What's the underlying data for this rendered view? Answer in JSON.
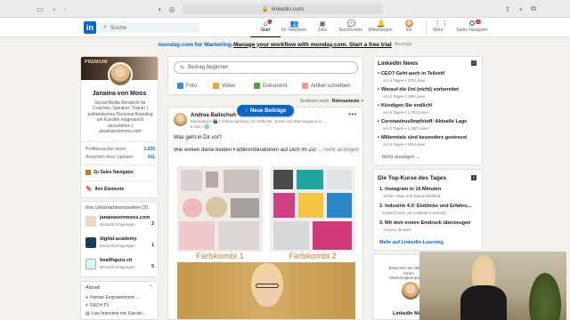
{
  "browser": {
    "url": "linkedin.com"
  },
  "nav": {
    "search_placeholder": "Suche",
    "items": [
      {
        "label": "Start",
        "badge": ""
      },
      {
        "label": "Ihr Netzwerk",
        "badge": ""
      },
      {
        "label": "Jobs",
        "badge": ""
      },
      {
        "label": "Nachrichten",
        "badge": ""
      },
      {
        "label": "Mitteilungen",
        "badge": ""
      },
      {
        "label": "Ich",
        "badge": ""
      },
      {
        "label": "Mehr",
        "badge": ""
      },
      {
        "label": "Sales Navigator",
        "badge": "99"
      }
    ],
    "start_badge": "1"
  },
  "ad_banner": {
    "brand": "monday.com for Marketing",
    "sep": " - ",
    "message": "Manage your workflow with monday.com. Start a free trial",
    "tag": "Anzeige"
  },
  "profile": {
    "premium": "PREMIUM",
    "name": "Janaina von Moos",
    "headline": "Social Media Beraterin für Coaches, Speaker, Trainer | authentisches Personal Branding um Kunden magnetisch anzuziehen | janainavonmoos.com",
    "stats": [
      {
        "label": "Profilbesucher:innen",
        "value": "1.025"
      },
      {
        "label": "Ansichten Ihrer Updates",
        "value": "411"
      }
    ],
    "sales_nav": "Zu Sales Navigator",
    "my_items": "Ihre Elemente"
  },
  "company_pages": {
    "title": "Ihre Unternehmensseiten (3)",
    "items": [
      {
        "name": "janainavonmoos.com",
        "sub": "Benachrichtigungen",
        "count": "2"
      },
      {
        "name": "digital-academy",
        "sub": "Benachrichtigungen",
        "count": "1"
      },
      {
        "name": "healthguru.ch",
        "sub": "Benachrichtigungen",
        "count": "5"
      }
    ]
  },
  "recent": {
    "title": "Aktuell",
    "items": [
      "Human Empowerment ...",
      "DACH TV",
      "Live Interview mit: Karolin..."
    ]
  },
  "composer": {
    "placeholder": "Beitrag beginnen",
    "actions": [
      "Foto",
      "Video",
      "Dokument",
      "Artikel schreiben"
    ]
  },
  "sort": {
    "label": "Sortieren nach:",
    "value": "Relevanteste"
  },
  "new_posts_button": "Neue Beiträge",
  "post": {
    "author": "Andrea Ballschuh",
    "degree": "• 1.",
    "sub": "Moderatorin 🎬 | Videocoaching | Ich helfe Dir, sicher und überzeugend in...",
    "time": "8 Std. • 🌐",
    "text1": "Was geht in Dir vor?",
    "text2": "Wie wirken diese beiden Farbkombinationen auf Dich im Zusammenhang",
    "more": "... mehr anzeigen",
    "label1": "Farbkombi 1",
    "label2": "Farbkombi 2"
  },
  "news": {
    "title": "LinkedIn News",
    "items": [
      {
        "title": "CEO? Geht auch in Teilzeit!",
        "meta": "vor 5 Tagen • 378 Leser"
      },
      {
        "title": "Worauf die Uni (nicht) vorbereitet",
        "meta": "vor 5 Tagen • 436 Leser"
      },
      {
        "title": "Kündigen Sie endlich!",
        "meta": "vor 9 Tagen • 1.702 Leser"
      },
      {
        "title": "Coronavirus/Impfstoff: Aktuelle Lage",
        "meta": "vor 2 Tagen • 1.000 Leser"
      },
      {
        "title": "Millennials sind besonders gestresst",
        "meta": "vor 6 Tagen • 355 Leser"
      }
    ],
    "more": "Mehr anzeigen"
  },
  "courses": {
    "title": "Die Top-Kurse des Tages",
    "items": [
      {
        "title": "1. Instagram in 10 Minuten",
        "author": "Achim Hepp und David Mühlfeld"
      },
      {
        "title": "2. Industrie 4.0: Einblicke und Erfahru...",
        "author": "Expert:innen von LinkedIn Learning"
      },
      {
        "title": "3. Mit dem ersten Eindruck überzeugen",
        "author": "Yvonne de Bark"
      }
    ],
    "more": "Mehr auf LinkedIn Learning"
  },
  "promo": {
    "text": "Brauchen Sie Hilfe bei Ihrem Marketingkampagne?",
    "footer": "LinkedIn Marke"
  }
}
